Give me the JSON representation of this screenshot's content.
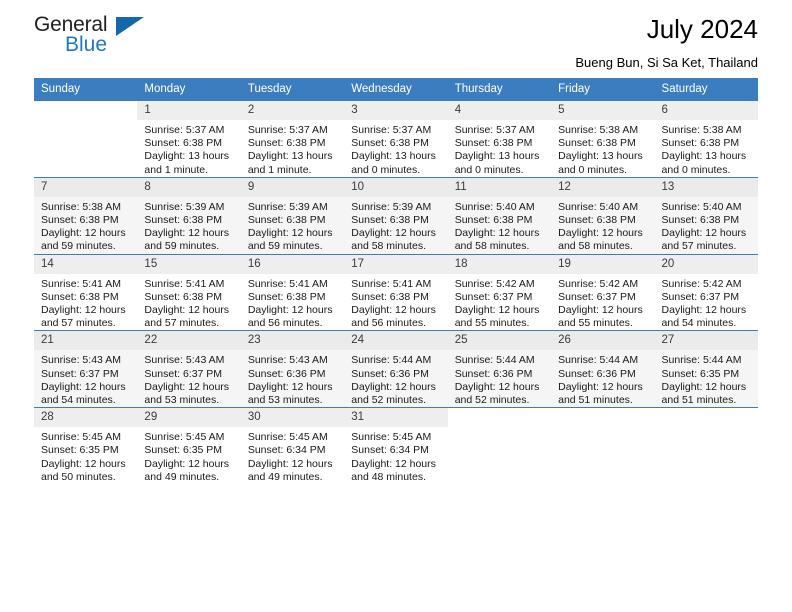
{
  "branding": {
    "logo_text_1": "General",
    "logo_text_2": "Blue",
    "accent_color": "#1f7ac0",
    "header_color": "#3c7dbf"
  },
  "header": {
    "title": "July 2024",
    "subtitle": "Bueng Bun, Si Sa Ket, Thailand"
  },
  "calendar": {
    "weekday_headers": [
      "Sunday",
      "Monday",
      "Tuesday",
      "Wednesday",
      "Thursday",
      "Friday",
      "Saturday"
    ],
    "weeks": [
      [
        {
          "day": "",
          "sunrise": "",
          "sunset": "",
          "daylight_1": "",
          "daylight_2": ""
        },
        {
          "day": "1",
          "sunrise": "Sunrise: 5:37 AM",
          "sunset": "Sunset: 6:38 PM",
          "daylight_1": "Daylight: 13 hours",
          "daylight_2": "and 1 minute."
        },
        {
          "day": "2",
          "sunrise": "Sunrise: 5:37 AM",
          "sunset": "Sunset: 6:38 PM",
          "daylight_1": "Daylight: 13 hours",
          "daylight_2": "and 1 minute."
        },
        {
          "day": "3",
          "sunrise": "Sunrise: 5:37 AM",
          "sunset": "Sunset: 6:38 PM",
          "daylight_1": "Daylight: 13 hours",
          "daylight_2": "and 0 minutes."
        },
        {
          "day": "4",
          "sunrise": "Sunrise: 5:37 AM",
          "sunset": "Sunset: 6:38 PM",
          "daylight_1": "Daylight: 13 hours",
          "daylight_2": "and 0 minutes."
        },
        {
          "day": "5",
          "sunrise": "Sunrise: 5:38 AM",
          "sunset": "Sunset: 6:38 PM",
          "daylight_1": "Daylight: 13 hours",
          "daylight_2": "and 0 minutes."
        },
        {
          "day": "6",
          "sunrise": "Sunrise: 5:38 AM",
          "sunset": "Sunset: 6:38 PM",
          "daylight_1": "Daylight: 13 hours",
          "daylight_2": "and 0 minutes."
        }
      ],
      [
        {
          "day": "7",
          "sunrise": "Sunrise: 5:38 AM",
          "sunset": "Sunset: 6:38 PM",
          "daylight_1": "Daylight: 12 hours",
          "daylight_2": "and 59 minutes."
        },
        {
          "day": "8",
          "sunrise": "Sunrise: 5:39 AM",
          "sunset": "Sunset: 6:38 PM",
          "daylight_1": "Daylight: 12 hours",
          "daylight_2": "and 59 minutes."
        },
        {
          "day": "9",
          "sunrise": "Sunrise: 5:39 AM",
          "sunset": "Sunset: 6:38 PM",
          "daylight_1": "Daylight: 12 hours",
          "daylight_2": "and 59 minutes."
        },
        {
          "day": "10",
          "sunrise": "Sunrise: 5:39 AM",
          "sunset": "Sunset: 6:38 PM",
          "daylight_1": "Daylight: 12 hours",
          "daylight_2": "and 58 minutes."
        },
        {
          "day": "11",
          "sunrise": "Sunrise: 5:40 AM",
          "sunset": "Sunset: 6:38 PM",
          "daylight_1": "Daylight: 12 hours",
          "daylight_2": "and 58 minutes."
        },
        {
          "day": "12",
          "sunrise": "Sunrise: 5:40 AM",
          "sunset": "Sunset: 6:38 PM",
          "daylight_1": "Daylight: 12 hours",
          "daylight_2": "and 58 minutes."
        },
        {
          "day": "13",
          "sunrise": "Sunrise: 5:40 AM",
          "sunset": "Sunset: 6:38 PM",
          "daylight_1": "Daylight: 12 hours",
          "daylight_2": "and 57 minutes."
        }
      ],
      [
        {
          "day": "14",
          "sunrise": "Sunrise: 5:41 AM",
          "sunset": "Sunset: 6:38 PM",
          "daylight_1": "Daylight: 12 hours",
          "daylight_2": "and 57 minutes."
        },
        {
          "day": "15",
          "sunrise": "Sunrise: 5:41 AM",
          "sunset": "Sunset: 6:38 PM",
          "daylight_1": "Daylight: 12 hours",
          "daylight_2": "and 57 minutes."
        },
        {
          "day": "16",
          "sunrise": "Sunrise: 5:41 AM",
          "sunset": "Sunset: 6:38 PM",
          "daylight_1": "Daylight: 12 hours",
          "daylight_2": "and 56 minutes."
        },
        {
          "day": "17",
          "sunrise": "Sunrise: 5:41 AM",
          "sunset": "Sunset: 6:38 PM",
          "daylight_1": "Daylight: 12 hours",
          "daylight_2": "and 56 minutes."
        },
        {
          "day": "18",
          "sunrise": "Sunrise: 5:42 AM",
          "sunset": "Sunset: 6:37 PM",
          "daylight_1": "Daylight: 12 hours",
          "daylight_2": "and 55 minutes."
        },
        {
          "day": "19",
          "sunrise": "Sunrise: 5:42 AM",
          "sunset": "Sunset: 6:37 PM",
          "daylight_1": "Daylight: 12 hours",
          "daylight_2": "and 55 minutes."
        },
        {
          "day": "20",
          "sunrise": "Sunrise: 5:42 AM",
          "sunset": "Sunset: 6:37 PM",
          "daylight_1": "Daylight: 12 hours",
          "daylight_2": "and 54 minutes."
        }
      ],
      [
        {
          "day": "21",
          "sunrise": "Sunrise: 5:43 AM",
          "sunset": "Sunset: 6:37 PM",
          "daylight_1": "Daylight: 12 hours",
          "daylight_2": "and 54 minutes."
        },
        {
          "day": "22",
          "sunrise": "Sunrise: 5:43 AM",
          "sunset": "Sunset: 6:37 PM",
          "daylight_1": "Daylight: 12 hours",
          "daylight_2": "and 53 minutes."
        },
        {
          "day": "23",
          "sunrise": "Sunrise: 5:43 AM",
          "sunset": "Sunset: 6:36 PM",
          "daylight_1": "Daylight: 12 hours",
          "daylight_2": "and 53 minutes."
        },
        {
          "day": "24",
          "sunrise": "Sunrise: 5:44 AM",
          "sunset": "Sunset: 6:36 PM",
          "daylight_1": "Daylight: 12 hours",
          "daylight_2": "and 52 minutes."
        },
        {
          "day": "25",
          "sunrise": "Sunrise: 5:44 AM",
          "sunset": "Sunset: 6:36 PM",
          "daylight_1": "Daylight: 12 hours",
          "daylight_2": "and 52 minutes."
        },
        {
          "day": "26",
          "sunrise": "Sunrise: 5:44 AM",
          "sunset": "Sunset: 6:36 PM",
          "daylight_1": "Daylight: 12 hours",
          "daylight_2": "and 51 minutes."
        },
        {
          "day": "27",
          "sunrise": "Sunrise: 5:44 AM",
          "sunset": "Sunset: 6:35 PM",
          "daylight_1": "Daylight: 12 hours",
          "daylight_2": "and 51 minutes."
        }
      ],
      [
        {
          "day": "28",
          "sunrise": "Sunrise: 5:45 AM",
          "sunset": "Sunset: 6:35 PM",
          "daylight_1": "Daylight: 12 hours",
          "daylight_2": "and 50 minutes."
        },
        {
          "day": "29",
          "sunrise": "Sunrise: 5:45 AM",
          "sunset": "Sunset: 6:35 PM",
          "daylight_1": "Daylight: 12 hours",
          "daylight_2": "and 49 minutes."
        },
        {
          "day": "30",
          "sunrise": "Sunrise: 5:45 AM",
          "sunset": "Sunset: 6:34 PM",
          "daylight_1": "Daylight: 12 hours",
          "daylight_2": "and 49 minutes."
        },
        {
          "day": "31",
          "sunrise": "Sunrise: 5:45 AM",
          "sunset": "Sunset: 6:34 PM",
          "daylight_1": "Daylight: 12 hours",
          "daylight_2": "and 48 minutes."
        },
        {
          "day": "",
          "sunrise": "",
          "sunset": "",
          "daylight_1": "",
          "daylight_2": ""
        },
        {
          "day": "",
          "sunrise": "",
          "sunset": "",
          "daylight_1": "",
          "daylight_2": ""
        },
        {
          "day": "",
          "sunrise": "",
          "sunset": "",
          "daylight_1": "",
          "daylight_2": ""
        }
      ]
    ]
  }
}
